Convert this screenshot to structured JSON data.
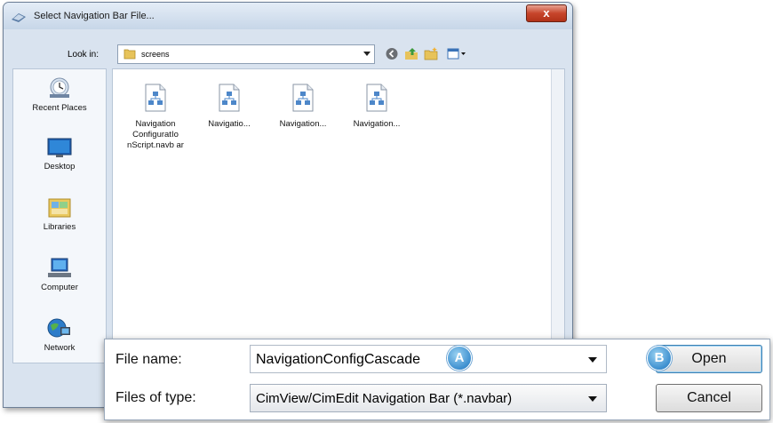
{
  "dialog": {
    "title": "Select Navigation Bar File...",
    "close_glyph": "x"
  },
  "lookin": {
    "label": "Look in:",
    "value": "screens",
    "toolbar_icons": [
      "back-icon",
      "up-folder-icon",
      "new-folder-icon",
      "view-menu-icon"
    ]
  },
  "places": [
    {
      "label": "Recent Places",
      "icon": "recent-places-icon"
    },
    {
      "label": "Desktop",
      "icon": "desktop-icon"
    },
    {
      "label": "Libraries",
      "icon": "libraries-icon"
    },
    {
      "label": "Computer",
      "icon": "computer-icon"
    },
    {
      "label": "Network",
      "icon": "network-icon"
    }
  ],
  "files": [
    {
      "name": "Navigation ConfiguratIo nScript.navb ar"
    },
    {
      "name": "Navigatio..."
    },
    {
      "name": "Navigation..."
    },
    {
      "name": "Navigation..."
    }
  ],
  "bottom": {
    "filename_label": "File name:",
    "filename_value": "NavigationConfigCascade",
    "filetype_label": "Files of type:",
    "filetype_value": "CimView/CimEdit Navigation Bar (*.navbar)",
    "open_label": "Open",
    "cancel_label": "Cancel",
    "badge_a": "A",
    "badge_b": "B"
  },
  "colors": {
    "dialog_bg": "#d9e3ef",
    "close_button": "#c7452b",
    "badge": "#3d8fcf"
  }
}
